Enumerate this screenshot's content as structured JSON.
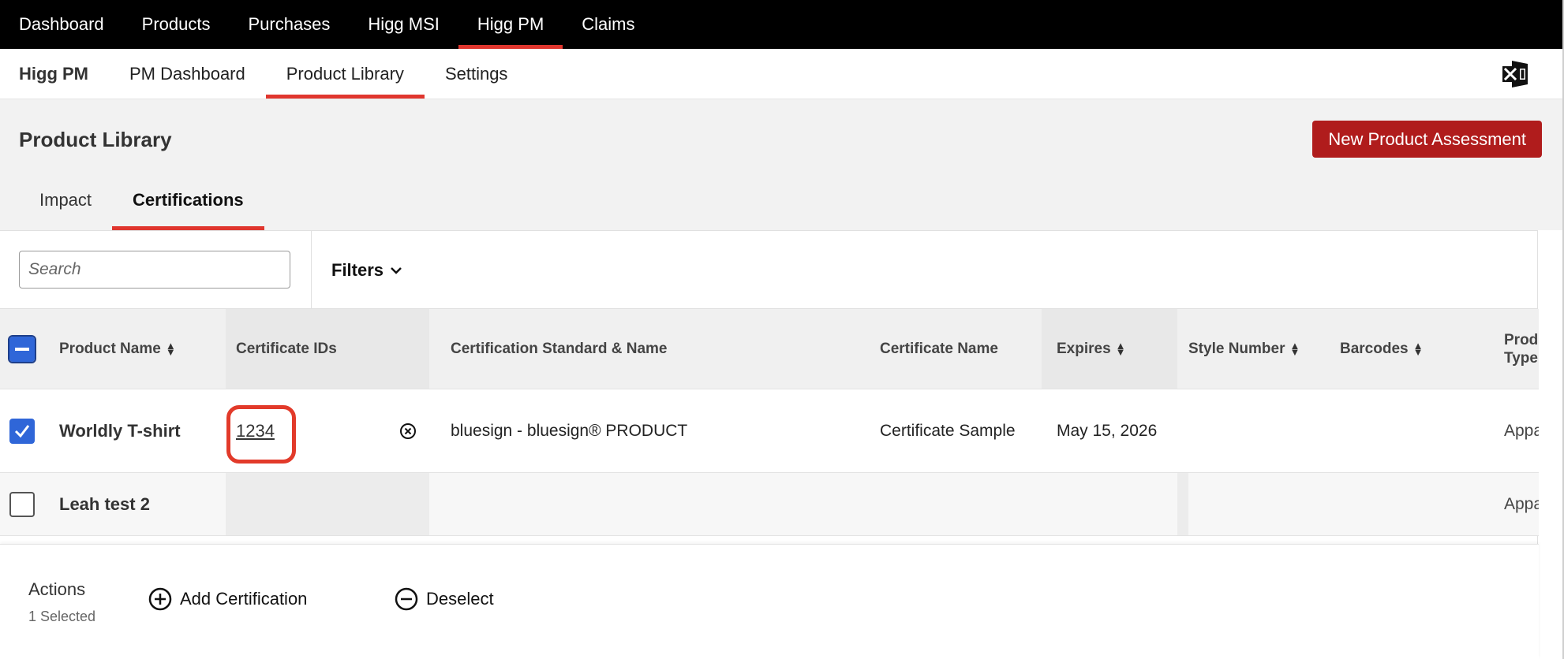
{
  "top_nav": {
    "items": [
      {
        "label": "Dashboard"
      },
      {
        "label": "Products"
      },
      {
        "label": "Purchases"
      },
      {
        "label": "Higg MSI"
      },
      {
        "label": "Higg PM",
        "active": true
      },
      {
        "label": "Claims"
      }
    ]
  },
  "sub_nav": {
    "brand": "Higg PM",
    "items": [
      {
        "label": "PM Dashboard"
      },
      {
        "label": "Product Library",
        "active": true
      },
      {
        "label": "Settings"
      }
    ],
    "export_icon": "excel-icon"
  },
  "page": {
    "title": "Product Library",
    "new_button": "New Product Assessment",
    "tabs": [
      {
        "label": "Impact"
      },
      {
        "label": "Certifications",
        "active": true
      }
    ]
  },
  "toolbar": {
    "search_placeholder": "Search",
    "filters_label": "Filters"
  },
  "table": {
    "columns": [
      {
        "label": "Product Name",
        "sortable": true
      },
      {
        "label": "Certificate IDs"
      },
      {
        "label": "Certification Standard & Name"
      },
      {
        "label": "Certificate Name"
      },
      {
        "label": "Expires",
        "sortable": true
      },
      {
        "label": "Style Number",
        "sortable": true
      },
      {
        "label": "Barcodes",
        "sortable": true
      },
      {
        "label": "Product Type"
      }
    ],
    "header_checkbox": "partial",
    "rows": [
      {
        "checked": true,
        "product_name": "Worldly T-shirt",
        "certificate_id": "1234",
        "standard_name": "bluesign - bluesign® PRODUCT",
        "certificate_name": "Certificate Sample",
        "expires": "May 15, 2026",
        "style_number": "",
        "barcodes": "",
        "product_type": "Apparel"
      },
      {
        "checked": false,
        "product_name": "Leah test 2",
        "certificate_id": "",
        "standard_name": "",
        "certificate_name": "",
        "expires": "",
        "style_number": "",
        "barcodes": "",
        "product_type": "Apparel"
      }
    ]
  },
  "actions": {
    "title": "Actions",
    "selected_count": "1 Selected",
    "add_label": "Add Certification",
    "deselect_label": "Deselect"
  },
  "colors": {
    "accent_red": "#e0362e",
    "button_red": "#b01c1c",
    "checkbox_blue": "#2f66d8"
  }
}
